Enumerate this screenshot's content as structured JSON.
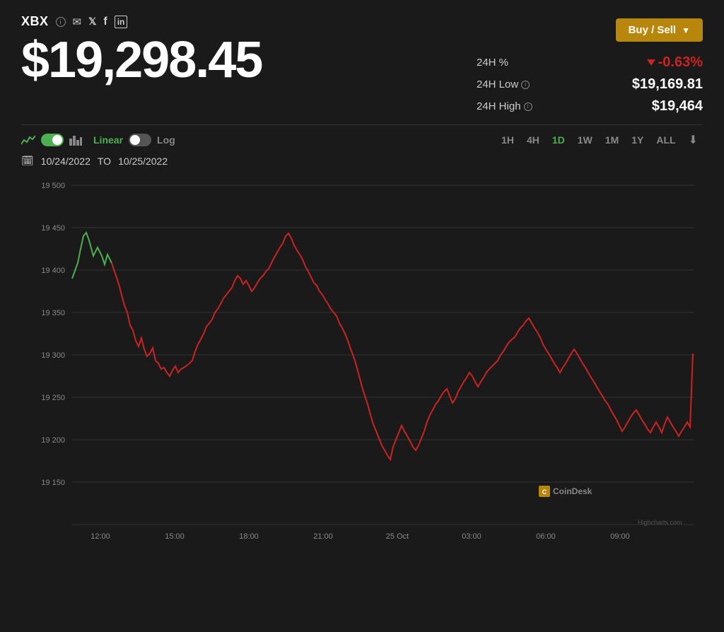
{
  "ticker": {
    "symbol": "XBX",
    "price": "$19,298.45",
    "stat_24h_pct_label": "24H %",
    "stat_24h_pct_value": "-0.63%",
    "stat_24h_low_label": "24H Low",
    "stat_24h_low_value": "$19,169.81",
    "stat_24h_high_label": "24H High",
    "stat_24h_high_value": "$19,464"
  },
  "buttons": {
    "buy_sell": "Buy / Sell"
  },
  "chart_controls": {
    "scale_linear": "Linear",
    "scale_log": "Log",
    "time_buttons": [
      "1H",
      "4H",
      "1D",
      "1W",
      "1M",
      "1Y",
      "ALL"
    ],
    "active_time": "1D"
  },
  "date_range": {
    "from": "10/24/2022",
    "to_label": "TO",
    "to": "10/25/2022"
  },
  "chart": {
    "y_labels": [
      "19 500",
      "19 450",
      "19 400",
      "19 350",
      "19 300",
      "19 250",
      "19 200",
      "19 150"
    ],
    "x_labels": [
      "12:00",
      "15:00",
      "18:00",
      "21:00",
      "25 Oct",
      "03:00",
      "06:00",
      "09:00"
    ],
    "watermark": "CoinDesk",
    "credit": "Highcharts.com"
  },
  "icons": {
    "info": "i",
    "mail": "✉",
    "twitter": "𝕏",
    "facebook": "f",
    "linkedin": "in",
    "line_chart": "📈",
    "bar_chart": "📊",
    "calendar": "📅",
    "download": "⬇"
  }
}
